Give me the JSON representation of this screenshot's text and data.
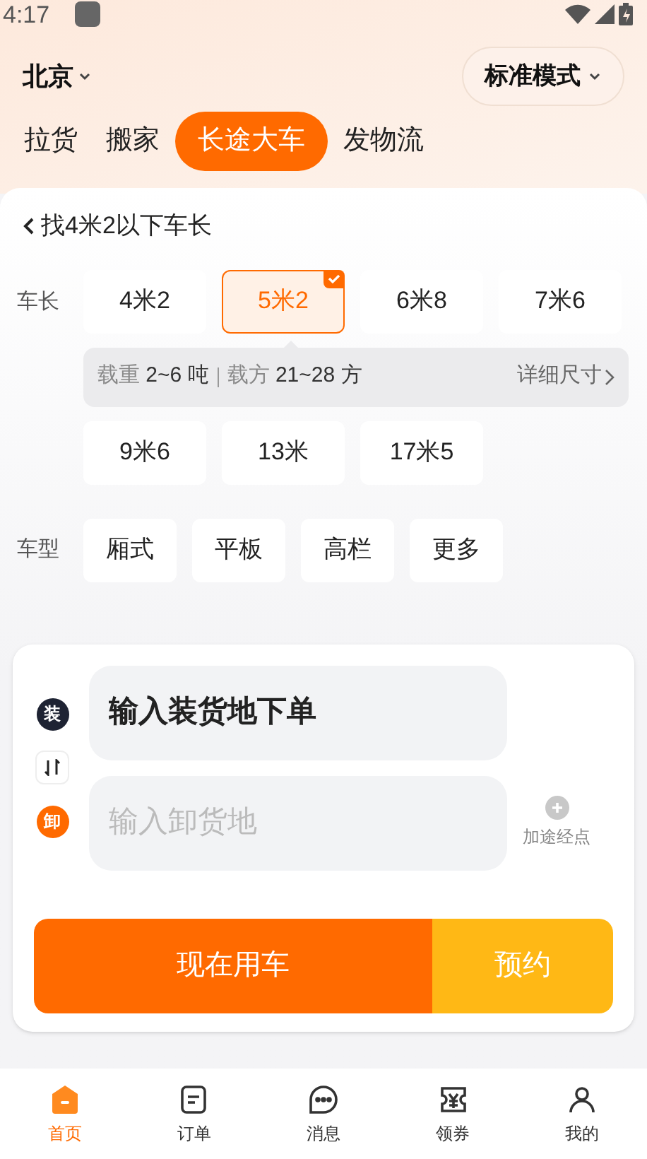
{
  "status_bar": {
    "time": "4:17"
  },
  "header": {
    "city": "北京",
    "mode": "标准模式"
  },
  "service_tabs": [
    {
      "label": "拉货",
      "selected": false
    },
    {
      "label": "搬家",
      "selected": false
    },
    {
      "label": "长途大车",
      "selected": true
    },
    {
      "label": "发物流",
      "selected": false
    }
  ],
  "back_link": "找4米2以下车长",
  "truck_length": {
    "label": "车长",
    "options": [
      {
        "label": "4米2",
        "selected": false
      },
      {
        "label": "5米2",
        "selected": true
      },
      {
        "label": "6米8",
        "selected": false
      },
      {
        "label": "7米6",
        "selected": false
      },
      {
        "label": "9米6",
        "selected": false
      },
      {
        "label": "13米",
        "selected": false
      },
      {
        "label": "17米5",
        "selected": false
      }
    ],
    "info": {
      "load_label": "载重",
      "load_value": "2~6 吨",
      "volume_label": "载方",
      "volume_value": "21~28 方",
      "detail_link": "详细尺寸"
    }
  },
  "truck_type": {
    "label": "车型",
    "options": [
      {
        "label": "厢式"
      },
      {
        "label": "平板"
      },
      {
        "label": "高栏"
      },
      {
        "label": "更多"
      }
    ]
  },
  "route": {
    "stops": [
      {
        "kind": "load",
        "badge": "装",
        "placeholder": "输入装货地下单"
      },
      {
        "kind": "unload",
        "badge": "卸",
        "placeholder": "输入卸货地"
      }
    ],
    "add_stop": "加途经点"
  },
  "actions": {
    "primary": "现在用车",
    "secondary": "预约"
  },
  "bottom_nav": [
    {
      "label": "首页",
      "kind": "home",
      "selected": true
    },
    {
      "label": "订单",
      "kind": "order",
      "selected": false
    },
    {
      "label": "消息",
      "kind": "message",
      "selected": false
    },
    {
      "label": "领券",
      "kind": "coupon",
      "selected": false
    },
    {
      "label": "我的",
      "kind": "user",
      "selected": false
    }
  ]
}
